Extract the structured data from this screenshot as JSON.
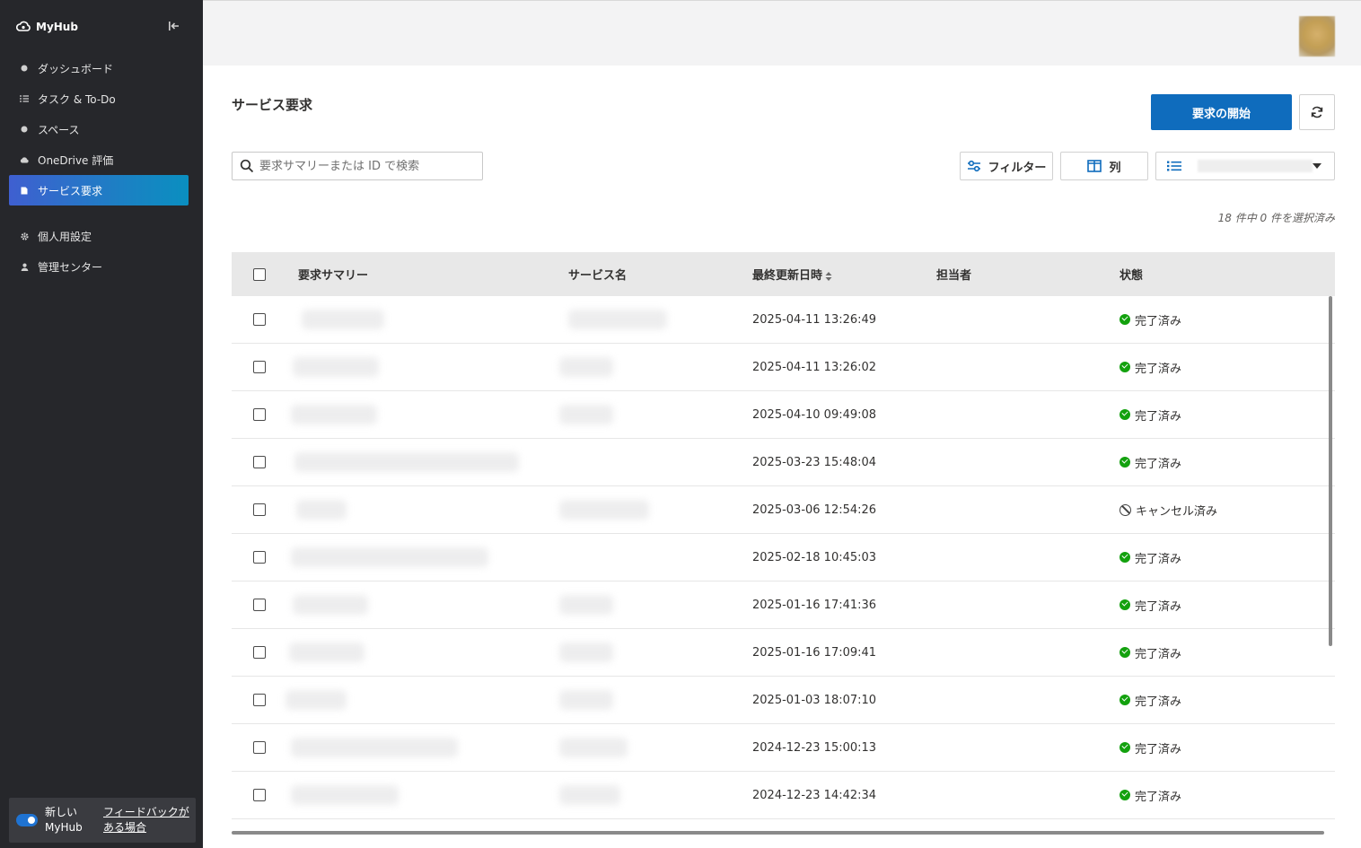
{
  "app": {
    "name": "MyHub"
  },
  "sidebar": {
    "items": [
      {
        "label": "ダッシュボード",
        "icon": "dashboard-icon"
      },
      {
        "label": "タスク & To-Do",
        "icon": "tasks-icon"
      },
      {
        "label": "スペース",
        "icon": "spaces-icon"
      },
      {
        "label": "OneDrive 評価",
        "icon": "cloud-icon"
      },
      {
        "label": "サービス要求",
        "icon": "document-icon",
        "active": true
      }
    ],
    "items2": [
      {
        "label": "個人用設定",
        "icon": "gear-icon"
      },
      {
        "label": "管理センター",
        "icon": "person-icon"
      }
    ],
    "footer": {
      "toggle_label": "新しい MyHub",
      "feedback_link": "フィードバックがある場合",
      "toggle_on": true
    }
  },
  "page": {
    "title": "サービス要求",
    "primary_button": "要求の開始",
    "search_placeholder": "要求サマリーまたは ID で検索",
    "filter_label": "フィルター",
    "columns_label": "列",
    "selected_count": "18 件中 0 件を選択済み"
  },
  "table": {
    "headers": {
      "summary": "要求サマリー",
      "service": "サービス名",
      "updated": "最終更新日時",
      "assignee": "担当者",
      "status": "状態"
    },
    "rows": [
      {
        "updated": "2025-04-11 13:26:49",
        "status": "完了済み",
        "state": "done"
      },
      {
        "updated": "2025-04-11 13:26:02",
        "status": "完了済み",
        "state": "done"
      },
      {
        "updated": "2025-04-10 09:49:08",
        "status": "完了済み",
        "state": "done"
      },
      {
        "updated": "2025-03-23 15:48:04",
        "status": "完了済み",
        "state": "done"
      },
      {
        "updated": "2025-03-06 12:54:26",
        "status": "キャンセル済み",
        "state": "cancelled"
      },
      {
        "updated": "2025-02-18 10:45:03",
        "status": "完了済み",
        "state": "done"
      },
      {
        "updated": "2025-01-16 17:41:36",
        "status": "完了済み",
        "state": "done"
      },
      {
        "updated": "2025-01-16 17:09:41",
        "status": "完了済み",
        "state": "done"
      },
      {
        "updated": "2025-01-03 18:07:10",
        "status": "完了済み",
        "state": "done"
      },
      {
        "updated": "2024-12-23 15:00:13",
        "status": "完了済み",
        "state": "done"
      },
      {
        "updated": "2024-12-23 14:42:34",
        "status": "完了済み",
        "state": "done"
      }
    ]
  },
  "colors": {
    "accent": "#0f6cbd",
    "sidebar_bg": "#26272b",
    "success": "#13a10e"
  }
}
